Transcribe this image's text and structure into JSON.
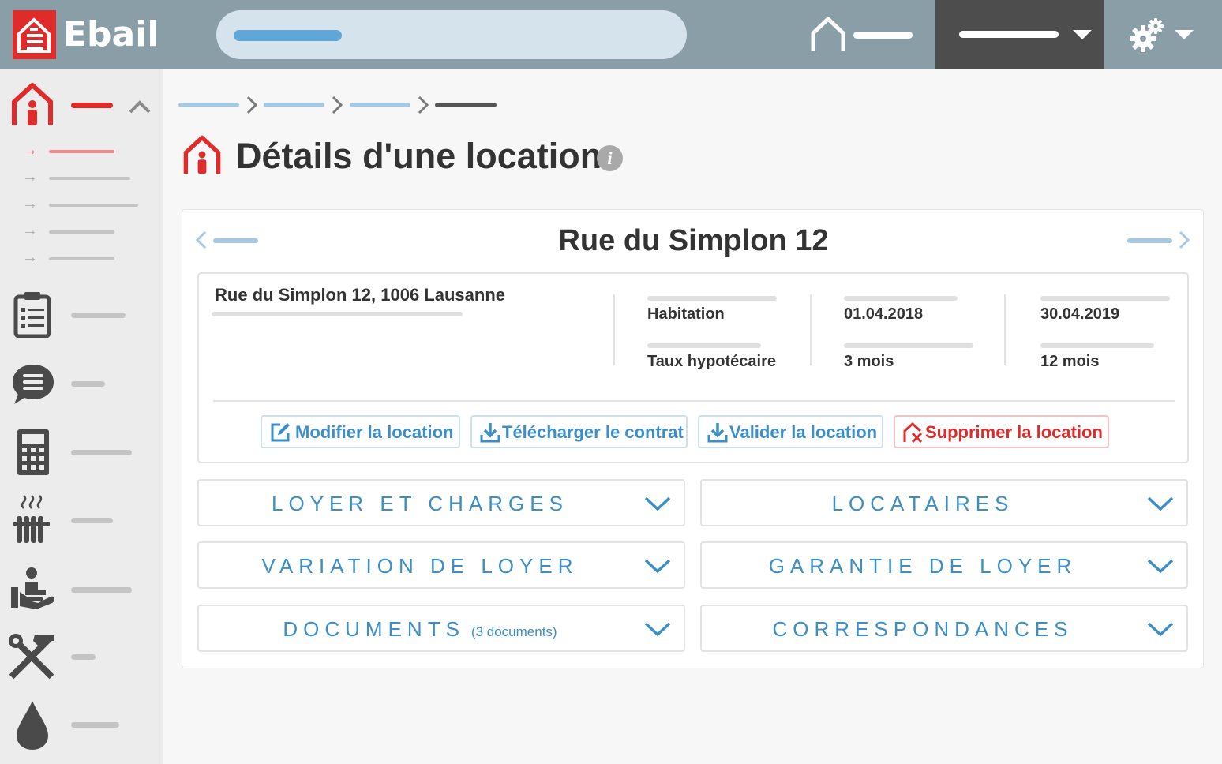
{
  "app": {
    "name": "Ebail"
  },
  "page": {
    "title": "Détails d'une location",
    "info_icon": "i"
  },
  "location": {
    "name": "Rue du Simplon 12",
    "address": "Rue du Simplon 12, 1006 Lausanne",
    "fields": [
      {
        "value": "Habitation"
      },
      {
        "value": "Taux hypotécaire"
      },
      {
        "value": "01.04.2018"
      },
      {
        "value": "3 mois"
      },
      {
        "value": "30.04.2019"
      },
      {
        "value": "12 mois"
      }
    ]
  },
  "actions": {
    "edit": "Modifier la location",
    "download": "Télécharger le contrat",
    "validate": "Valider la location",
    "delete": "Supprimer la location"
  },
  "sections": {
    "rent": "LOYER ET CHARGES",
    "tenants": "LOCATAIRES",
    "variation": "VARIATION DE LOYER",
    "guarantee": "GARANTIE DE LOYER",
    "documents": "DOCUMENTS",
    "documents_count": "(3 documents)",
    "correspondence": "CORRESPONDANCES"
  },
  "colors": {
    "brand_red": "#e02b2b",
    "topbar": "#8a9ea8",
    "accent_blue": "#3c8ec6"
  }
}
